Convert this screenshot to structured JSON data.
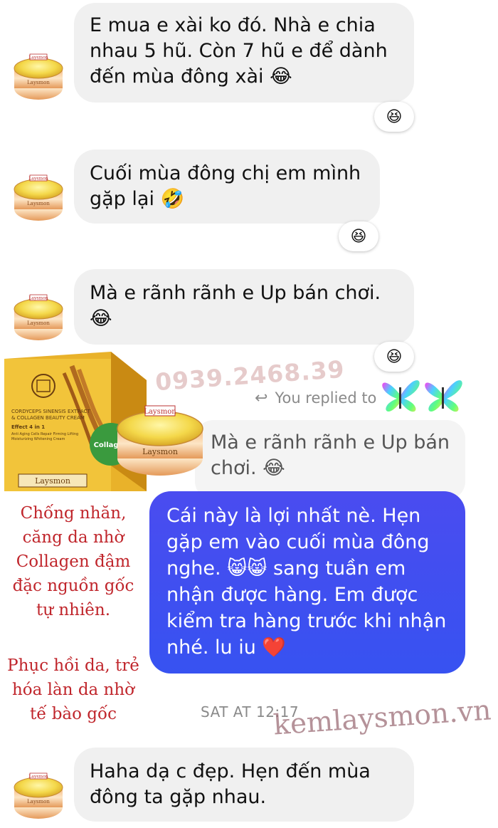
{
  "messages": [
    {
      "text": "E mua e xài ko đó. Nhà e chia\nnhau 5 hũ. Còn 7 hũ e để dành\nđến mùa đông xài",
      "emoji": "😂",
      "reaction": "😆"
    },
    {
      "text": "Cuối mùa đông chị em mình\ngặp lại",
      "emoji": "🤣",
      "reaction": "😆"
    },
    {
      "text": "Mà e rãnh rãnh e Up bán chơi.",
      "emoji": "😂",
      "reaction": "😆"
    }
  ],
  "reply": {
    "label": "You replied to",
    "quoted_text": "Mà e rãnh rãnh e Up bán\nchơi.",
    "quoted_emoji": "😂"
  },
  "blue_message": {
    "line1": "Cái này là lợi nhất nè. Hẹn",
    "line2": "gặp em vào cuối mùa đông",
    "line3_a": "nghe. ",
    "line3_emoji": "😸😸",
    "line3_b": " sang tuần em",
    "line4": "nhận được hàng. Em được",
    "line5": "kiểm tra hàng trước khi nhận",
    "line6": "nhé. lu iu ",
    "heart": "❤️"
  },
  "timestamp": "SAT AT 12:17",
  "last_message": {
    "text": "Haha dạ c đẹp. Hẹn đến mùa\nđông ta gặp nhau."
  },
  "ad": {
    "phone": "0939.2468.39",
    "brand": "Laysmon",
    "box_lines": [
      "CORDYCEPS SINENSIS EXTRACT",
      "& COLLAGEN BEAUTY CREAM",
      "Effect 4 in 1",
      "Anti Aging Cells Repair Firming Lifting",
      "Moisturizing Whitening Cream"
    ],
    "box_badge": "Collagen",
    "claim1": "Chống nhăn,\ncăng da nhờ\nCollagen đậm\nđặc nguồn gốc\ntự nhiên.",
    "claim2": "Phục hồi da, trẻ\nhóa làn da nhờ\ntế bào gốc",
    "site": "kemlaysmon.vn"
  },
  "colors": {
    "bubble": "#f0f0f0",
    "blue": "#3c4ff0",
    "red": "#c0262c"
  }
}
